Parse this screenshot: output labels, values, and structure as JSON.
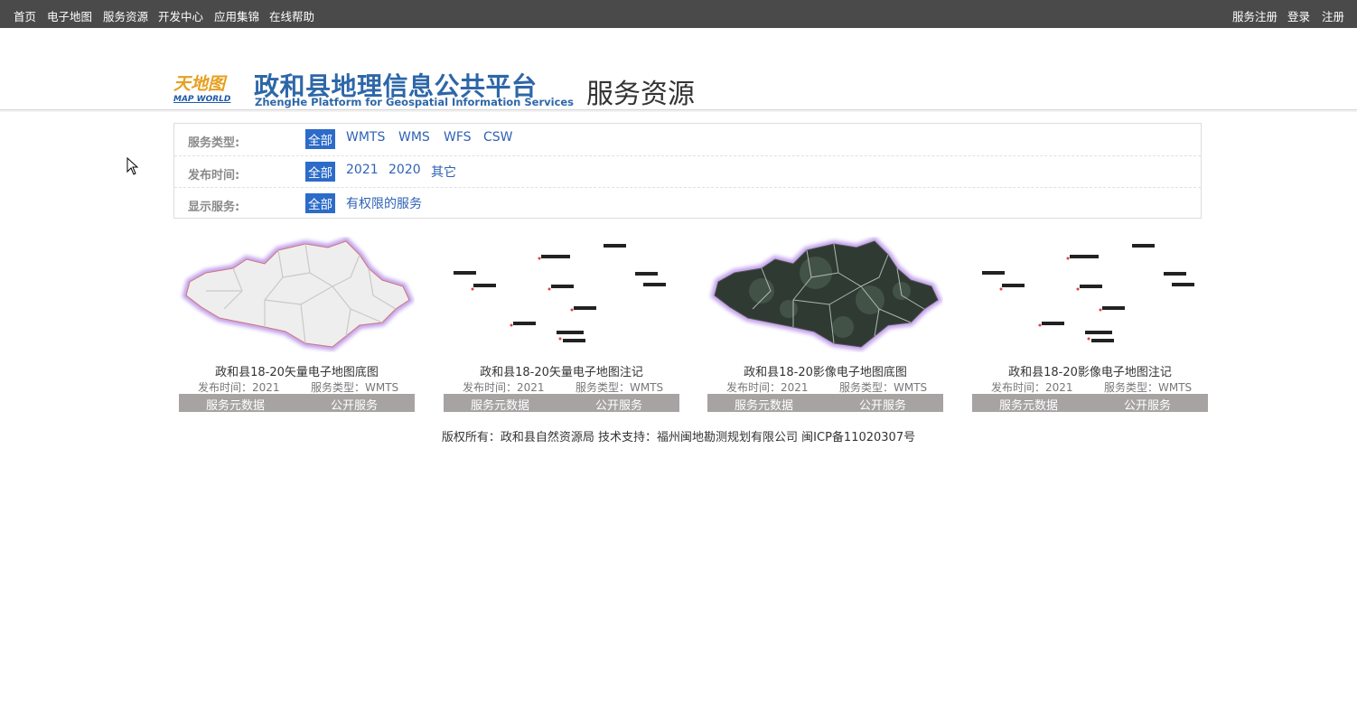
{
  "topnav": {
    "left": [
      "首页",
      "电子地图",
      "服务资源",
      "开发中心",
      "应用集锦",
      "在线帮助"
    ],
    "right": [
      "服务注册",
      "登录",
      "注册"
    ]
  },
  "header": {
    "logo_cn": "天地图",
    "logo_en": "MAP WORLD",
    "title": "政和县地理信息公共平台",
    "subtitle": "ZhengHe Platform for Geospatial Information Services",
    "section": "服务资源"
  },
  "filters": [
    {
      "label": "服务类型:",
      "options": [
        "全部",
        "WMTS",
        "WMS",
        "WFS",
        "CSW"
      ],
      "active": 0
    },
    {
      "label": "发布时间:",
      "options": [
        "全部",
        "2021",
        "2020",
        "其它"
      ],
      "active": 0
    },
    {
      "label": "显示服务:",
      "options": [
        "全部",
        "有权限的服务"
      ],
      "active": 0
    }
  ],
  "cards": [
    {
      "title": "政和县18-20矢量电子地图底图",
      "publish": "发布时间：2021",
      "type": "服务类型：WMTS",
      "thumb": "vector-map-thumbnail",
      "btn_meta": "服务元数据",
      "btn_public": "公开服务"
    },
    {
      "title": "政和县18-20矢量电子地图注记",
      "publish": "发布时间：2021",
      "type": "服务类型：WMTS",
      "thumb": "annotation-thumbnail",
      "btn_meta": "服务元数据",
      "btn_public": "公开服务"
    },
    {
      "title": "政和县18-20影像电子地图底图",
      "publish": "发布时间：2021",
      "type": "服务类型：WMTS",
      "thumb": "imagery-map-thumbnail",
      "btn_meta": "服务元数据",
      "btn_public": "公开服务"
    },
    {
      "title": "政和县18-20影像电子地图注记",
      "publish": "发布时间：2021",
      "type": "服务类型：WMTS",
      "thumb": "annotation-thumbnail",
      "btn_meta": "服务元数据",
      "btn_public": "公开服务"
    }
  ],
  "footer": "版权所有：政和县自然资源局 技术支持：福州闽地勘测规划有限公司 闽ICP备11020307号",
  "colors": {
    "topbar": "#4a4a4a",
    "title": "#2e67a8",
    "link": "#2f62b5",
    "active": "#2d6bc9",
    "button_bar": "#a7a3a3"
  }
}
